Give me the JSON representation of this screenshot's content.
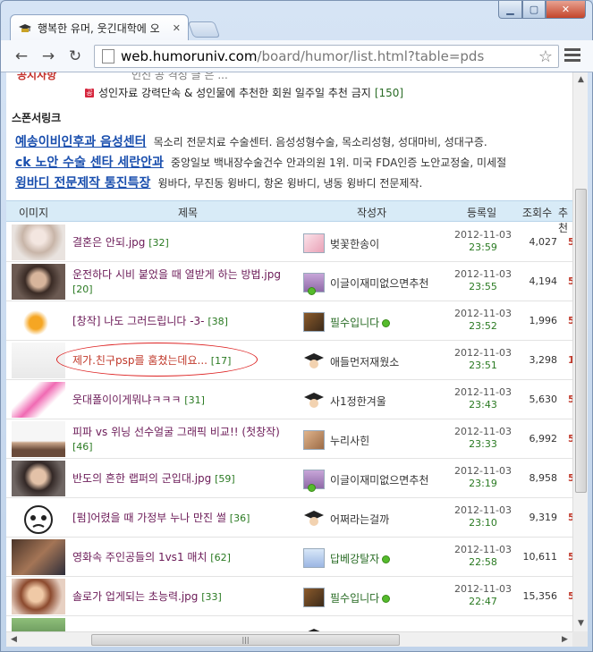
{
  "browser": {
    "tab_title": "행복한 유머, 웃긴대학에 오",
    "url_host": "web.humoruniv.com",
    "url_path": "/board/humor/list.html?table=pds"
  },
  "page": {
    "partial_top_left": "공지사항",
    "partial_top_right": "인신 공 격성 글 은 ...",
    "notice_text": "성인자료 강력단속 & 성인물에 추천한 회원 일주일 추천 금지",
    "notice_count": "[150]",
    "sponsor_heading": "스폰서링크",
    "sponsors": [
      {
        "title": "예송이비인후과 음성센터",
        "desc": "목소리 전문치료 수술센터. 음성성형수술, 목소리성형, 성대마비, 성대구증."
      },
      {
        "title": "ck 노안 수술 센타 세란안과",
        "desc": "중앙일보 백내장수술건수 안과의원 1위. 미국 FDA인증 노안교정술, 미세절"
      },
      {
        "title": "윙바디 전문제작 통진특장",
        "desc": "윙바다, 무진동 윙바디, 항온 윙바디, 냉동 윙바디 전문제작."
      }
    ]
  },
  "table": {
    "headers": [
      "이미지",
      "제목",
      "작성자",
      "등록일",
      "조회수",
      "추천"
    ],
    "rows": [
      {
        "title": "결혼은 안되.jpg",
        "comments": "[32]",
        "author": "벚꽃한송이",
        "author_green": false,
        "online": false,
        "date": "2012-11-03",
        "time": "23:59",
        "views": "4,027",
        "rec": "5"
      },
      {
        "title": "운전하다 시비 붙었을 때 열받게 하는 방법.jpg",
        "comments": "[20]",
        "author": "이글이재미없으면추천",
        "author_green": false,
        "online": true,
        "date": "2012-11-03",
        "time": "23:55",
        "views": "4,194",
        "rec": "5"
      },
      {
        "title": "[창작] 나도 그러드립니다 -3-",
        "comments": "[38]",
        "author": "필수입니다",
        "author_green": true,
        "online": true,
        "date": "2012-11-03",
        "time": "23:52",
        "views": "1,996",
        "rec": "5"
      },
      {
        "title": "제가.친구psp를 훔쳤는데요...",
        "comments": "[17]",
        "author": "애들먼저재웠소",
        "author_green": false,
        "online": false,
        "date": "2012-11-03",
        "time": "23:51",
        "views": "3,298",
        "rec": "1"
      },
      {
        "title": "웃대폴이이게뭐냐ㅋㅋㅋ",
        "comments": "[31]",
        "author": "사1정한겨울",
        "author_green": false,
        "online": false,
        "date": "2012-11-03",
        "time": "23:43",
        "views": "5,630",
        "rec": "5"
      },
      {
        "title": "피파 vs 위닝 선수얼굴 그래픽 비교!! (첫창작)",
        "comments": "[46]",
        "author": "누리사힌",
        "author_green": false,
        "online": false,
        "date": "2012-11-03",
        "time": "23:33",
        "views": "6,992",
        "rec": "5"
      },
      {
        "title": "반도의 흔한 랩퍼의 군입대.jpg",
        "comments": "[59]",
        "author": "이글이재미없으면추천",
        "author_green": false,
        "online": true,
        "date": "2012-11-03",
        "time": "23:19",
        "views": "8,958",
        "rec": "5"
      },
      {
        "title": "[펌]어렸을 때 가정부 누나 만진 썰",
        "comments": "[36]",
        "author": "어쩌라는걸까",
        "author_green": false,
        "online": false,
        "date": "2012-11-03",
        "time": "23:10",
        "views": "9,319",
        "rec": "5"
      },
      {
        "title": "영화속 주인공들의 1vs1 매치",
        "comments": "[62]",
        "author": "답베강탈자",
        "author_green": true,
        "online": true,
        "date": "2012-11-03",
        "time": "22:58",
        "views": "10,611",
        "rec": "5"
      },
      {
        "title": "솔로가 업게되는 초능력.jpg",
        "comments": "[33]",
        "author": "필수입니다",
        "author_green": true,
        "online": true,
        "date": "2012-11-03",
        "time": "22:47",
        "views": "15,356",
        "rec": "5"
      }
    ]
  },
  "icons": {
    "favicon": "graduation-cap-icon",
    "back": "arrow-left-icon",
    "forward": "arrow-right-icon",
    "reload": "reload-icon",
    "bookmark": "star-icon",
    "menu": "hamburger-menu-icon"
  }
}
